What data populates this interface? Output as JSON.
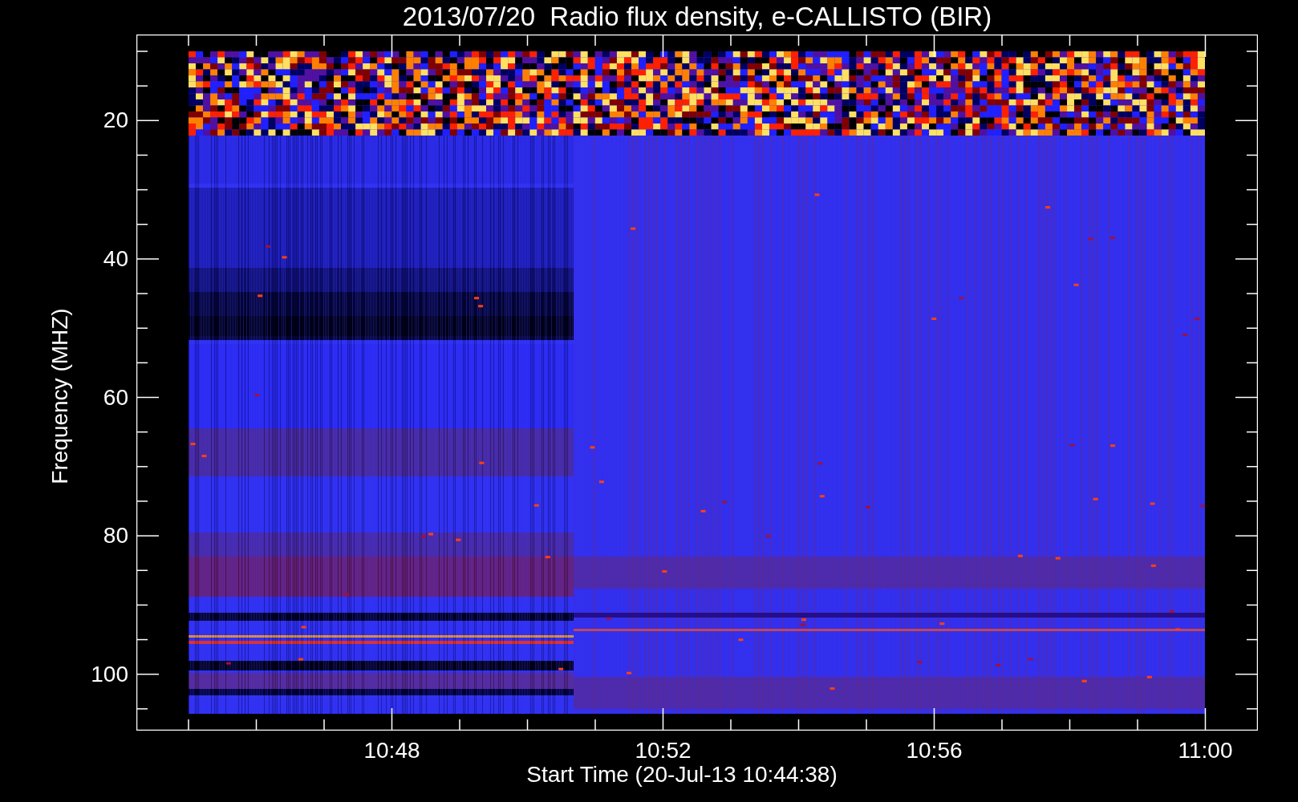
{
  "plot": {
    "title": "2013/07/20  Radio flux density, e-CALLISTO (BIR)",
    "ylabel": "Frequency (MHZ)",
    "xlabel": "Start Time (20-Jul-13 10:44:38)",
    "y_ticks": [
      "20",
      "40",
      "60",
      "80",
      "100"
    ],
    "x_ticks": [
      "10:48",
      "10:52",
      "10:56",
      "11:00"
    ]
  }
}
